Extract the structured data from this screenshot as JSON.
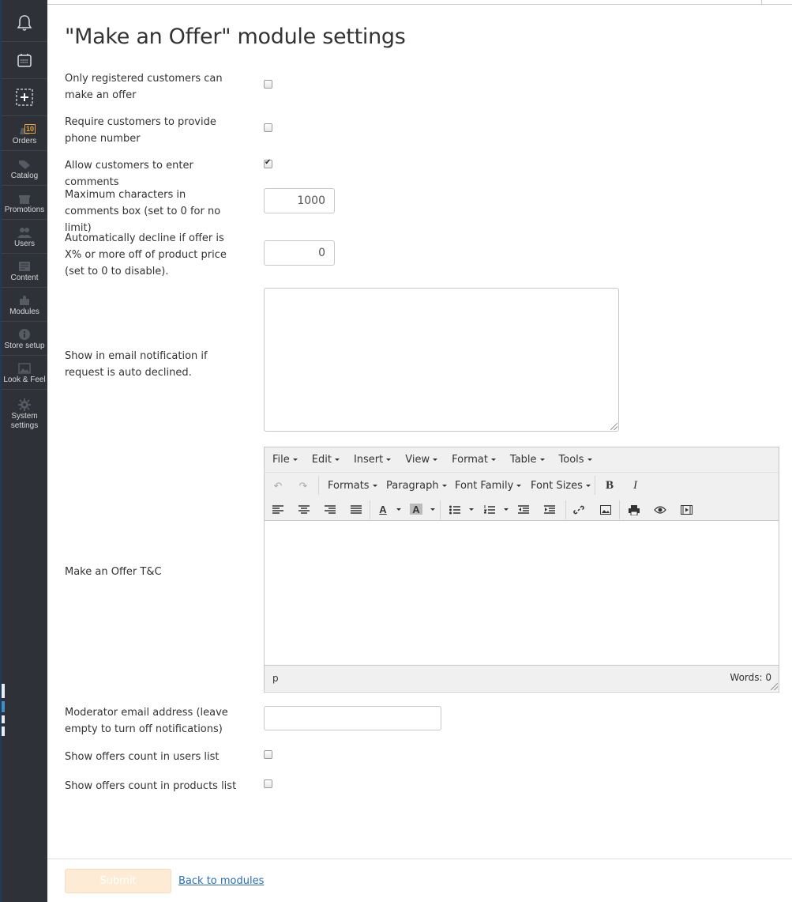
{
  "page": {
    "title": "\"Make an Offer\" module settings"
  },
  "sidebar": {
    "items": [
      {
        "label": "",
        "icon": "bell-icon"
      },
      {
        "label": "",
        "icon": "storefront-icon"
      },
      {
        "label": "",
        "icon": "add-block-icon"
      },
      {
        "label": "Orders",
        "icon": "orders-icon",
        "badge": "10"
      },
      {
        "label": "Catalog",
        "icon": "tag-icon"
      },
      {
        "label": "Promotions",
        "icon": "gift-icon"
      },
      {
        "label": "Users",
        "icon": "users-icon"
      },
      {
        "label": "Content",
        "icon": "content-icon"
      },
      {
        "label": "Modules",
        "icon": "puzzle-icon"
      },
      {
        "label": "Store setup",
        "icon": "info-icon"
      },
      {
        "label": "Look & Feel",
        "icon": "image-icon"
      },
      {
        "label": "System settings",
        "icon": "gear-icon"
      }
    ]
  },
  "form": {
    "registered_only": {
      "label": "Only registered customers can make an offer",
      "checked": false
    },
    "require_phone": {
      "label": "Require customers to provide phone number",
      "checked": false
    },
    "allow_comments": {
      "label": "Allow customers to enter comments",
      "checked": true
    },
    "max_chars": {
      "label": "Maximum characters in comments box (set to 0 for no limit)",
      "value": "1000"
    },
    "auto_decline": {
      "label": "Automatically decline if offer is X% or more off of product price (set to 0 to disable).",
      "value": "0"
    },
    "decline_email": {
      "label": "Show in email notification if request is auto declined.",
      "value": ""
    },
    "tnc": {
      "label": "Make an Offer T&C"
    },
    "moderator_email": {
      "label": "Moderator email address (leave empty to turn off notifications)",
      "value": ""
    },
    "users_count": {
      "label": "Show offers count in users list",
      "checked": false
    },
    "products_count": {
      "label": "Show offers count in products list",
      "checked": false
    }
  },
  "editor": {
    "menu": [
      "File",
      "Edit",
      "Insert",
      "View",
      "Format",
      "Table",
      "Tools"
    ],
    "formats": "Formats",
    "paragraph": "Paragraph",
    "font_family": "Font Family",
    "font_sizes": "Font Sizes",
    "bold": "B",
    "italic": "I",
    "path": "p",
    "word_count": "Words: 0"
  },
  "footer": {
    "submit": "Submit",
    "back": "Back to modules"
  },
  "colors": {
    "sidebar_bg": "#2e3138",
    "submit_bg": "#fdebd6",
    "link": "#2a6fb8",
    "badge": "#e8a33a"
  }
}
